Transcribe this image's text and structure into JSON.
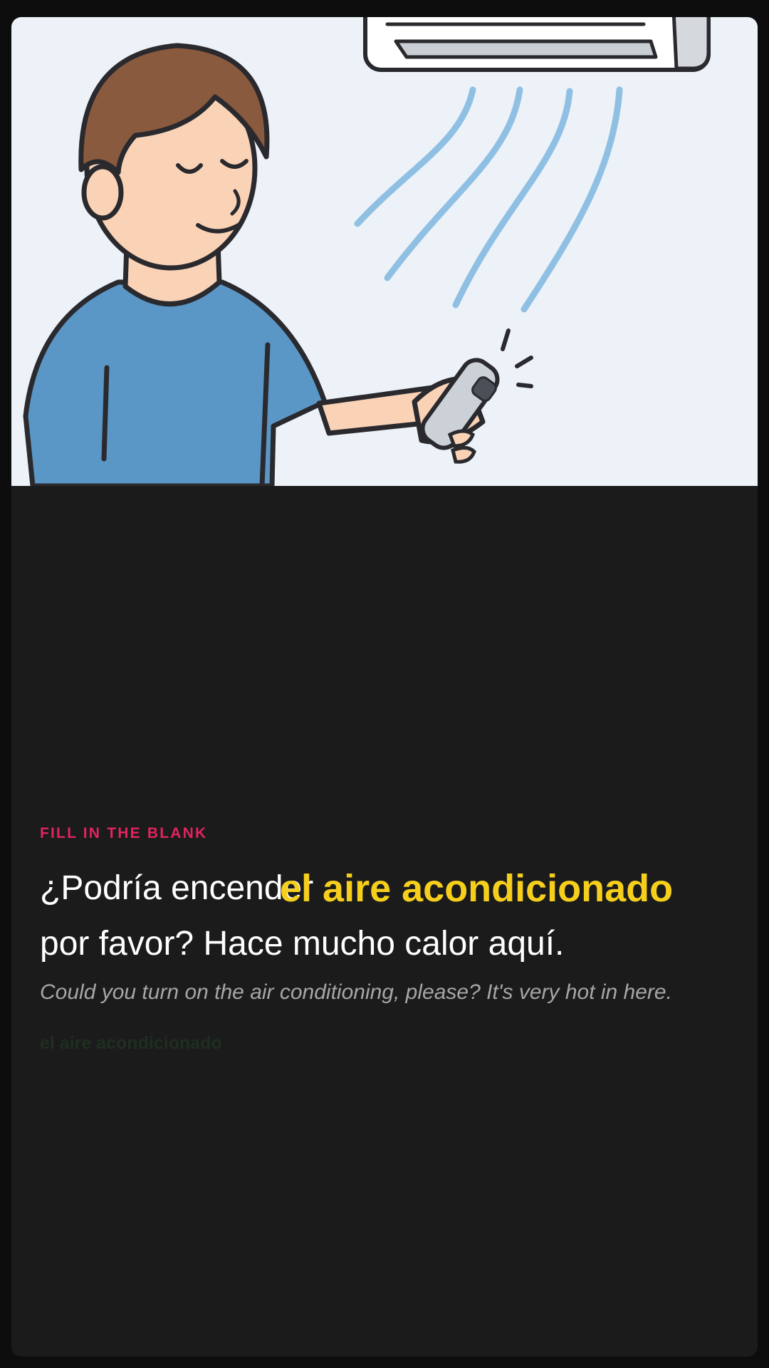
{
  "exercise": {
    "label": "FILL IN THE BLANK",
    "sentence_line1": "¿Podría encender",
    "sentence_line2": "por favor? Hace mucho calor aquí.",
    "answer": "el aire acondicionado",
    "translation": "Could you turn on the air conditioning, please? It's very hot in here.",
    "hint": "el aire acondicionado"
  },
  "colors": {
    "label": "#e0245e",
    "answer": "#f5cf1c",
    "card_background": "#1b1b1b",
    "illustration_background": "#edf2f8",
    "shirt": "#5a97c6",
    "hair": "#8a5a3e",
    "skin": "#fad3b7",
    "air_flow": "#7fb8e0"
  },
  "illustration": {
    "subject": "person-with-air-conditioner-remote",
    "icons": [
      "air-conditioner-icon",
      "remote-control-icon",
      "air-flow-icon"
    ]
  }
}
